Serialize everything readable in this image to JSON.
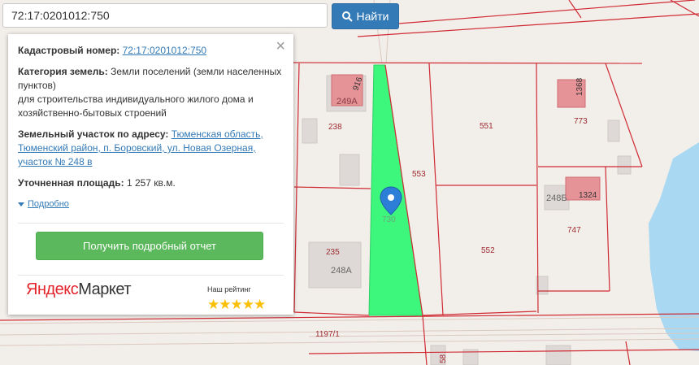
{
  "search": {
    "value": "72:17:0201012:750",
    "button_label": "Найти"
  },
  "info": {
    "cadastral_label": "Кадастровый номер:",
    "cadastral_value": "72:17:0201012:750",
    "category_label": "Категория земель:",
    "category_value": "Земли поселений (земли населенных пунктов)",
    "purpose": "для строительства индивидуального жилого дома и хозяйственно-бытовых строений",
    "address_label": "Земельный участок по адресу:",
    "address_value": "Тюменская область, Тюменский район, п. Боровский, ул. Новая Озерная, участок № 248 в",
    "area_label": "Уточненная площадь:",
    "area_value": "1 257 кв.м.",
    "more_label": "Подробно",
    "report_button": "Получить подробный отчет"
  },
  "ad": {
    "brand_yandex": "Яндекс",
    "brand_market": "Маркет",
    "rating_label": "Наш рейтинг",
    "stars": "★★★★★"
  },
  "map_labels": [
    "249А",
    "916",
    "238",
    "551",
    "1368",
    "773",
    "553",
    "730",
    "248Б",
    "1324",
    "747",
    "235",
    "248А",
    "552",
    "1197/1",
    "58"
  ],
  "colors": {
    "parcel_fill": "#3df77d",
    "boundary": "#d02b34",
    "water": "#a8d8f2",
    "building": "#e59397",
    "button_blue": "#337ab7",
    "button_green": "#5cb85c",
    "marker": "#2c7ed6"
  }
}
